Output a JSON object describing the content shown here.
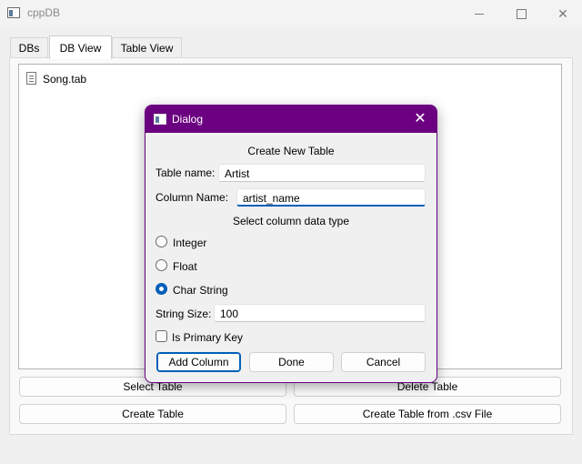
{
  "window": {
    "title": "cppDB"
  },
  "tabs": [
    {
      "label": "DBs"
    },
    {
      "label": "DB View",
      "active": true
    },
    {
      "label": "Table View"
    }
  ],
  "list": {
    "items": [
      {
        "label": "Song.tab",
        "icon": "document-icon"
      }
    ]
  },
  "buttons": {
    "select_table": "Select Table",
    "delete_table": "Delete Table",
    "create_table": "Create Table",
    "create_from_csv": "Create Table from .csv File"
  },
  "dialog": {
    "title": "Dialog",
    "heading": "Create New Table",
    "table_name_label": "Table name:",
    "table_name_value": "Artist",
    "column_name_label": "Column Name:",
    "column_name_value": "artist_name",
    "datatype_heading": "Select column data type",
    "types": [
      {
        "label": "Integer",
        "checked": false
      },
      {
        "label": "Float",
        "checked": false
      },
      {
        "label": "Char String",
        "checked": true
      }
    ],
    "string_size_label": "String Size:",
    "string_size_value": "100",
    "primary_key_label": "Is Primary Key",
    "primary_key_checked": false,
    "add_column_label": "Add Column",
    "done_label": "Done",
    "cancel_label": "Cancel"
  },
  "colors": {
    "dialog_accent": "#6b0080",
    "focus_blue": "#005fb8"
  }
}
